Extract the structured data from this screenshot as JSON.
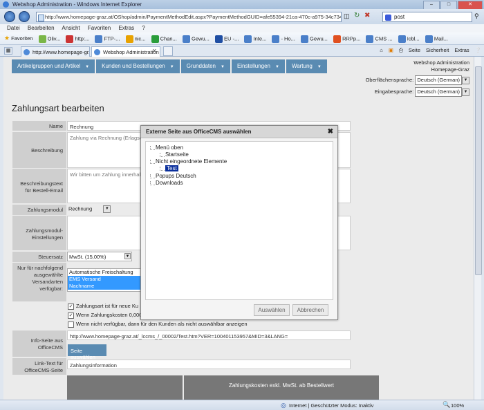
{
  "window": {
    "title": "Webshop Administration - Windows Internet Explorer"
  },
  "address": {
    "url": "http://www.homepage-graz.at/OShop/admin/PaymentMethodEdit.aspx?PaymentMethodGUID=afe55394-21ca-470c-a975-34c7348e6ed",
    "search": "post"
  },
  "menubar": [
    "Datei",
    "Bearbeiten",
    "Ansicht",
    "Favoriten",
    "Extras",
    "?"
  ],
  "favbar": {
    "label": "Favoriten",
    "items": [
      "Oliv...",
      "http:...",
      "FTP-...",
      "nic...",
      "Chan...",
      "Gewu...",
      "EU -...",
      "Inte...",
      "- Ho...",
      "Gewu...",
      "RRPp...",
      "CMS ...",
      "Icbl...",
      "Mail..."
    ]
  },
  "tabs": [
    {
      "label": "http://www.homepage-gr..."
    },
    {
      "label": "Webshop Administration"
    }
  ],
  "commandbar": [
    "Seite",
    "Sicherheit",
    "Extras"
  ],
  "nav": [
    {
      "label": "Artikelgruppen und Artikel"
    },
    {
      "label": "Kunden und Bestellungen"
    },
    {
      "label": "Grunddaten"
    },
    {
      "label": "Einstellungen"
    },
    {
      "label": "Wartung"
    }
  ],
  "header": {
    "line1": "Webshop Administration",
    "line2": "Homepage-Graz",
    "ui_lang_label": "Oberflächensprache:",
    "ui_lang_value": "Deutsch (German)",
    "input_lang_label": "Eingabesprache:",
    "input_lang_value": "Deutsch (German)"
  },
  "page_title": "Zahlungsart bearbeiten",
  "form": {
    "name_label": "Name",
    "name_value": "Rechnung",
    "desc_label": "Beschreibung",
    "desc_value": "Zahlung via Rechnung (Erlagsche",
    "email_desc_label": "Beschreibungstext für Bestell-Email",
    "email_desc_value": "Wir bitten um Zahlung innerhalb",
    "module_label": "Zahlungsmodul",
    "module_value": "Rechnung",
    "module_settings_label": "Zahlungsmodul-Einstellungen",
    "tax_label": "Steuersatz",
    "tax_value": "MwSt. (15,00%)",
    "shipping_label": "Nur für nachfolgend ausgewählte Versandarten verfügbar:",
    "shipping_options": [
      "Automatische Freischaltung",
      "EMS Versand",
      "Nachname"
    ],
    "check1": "Zahlungsart ist für neue Ku",
    "check2": "Wenn Zahlungskosten 0,000",
    "check3": "Wenn nicht verfügbar, dann für den Kunden als nicht auswählbar anzeigen",
    "info_page_label": "Info-Seite aus OfficeCMS",
    "info_page_value": "http://www.homepage-graz.at/_lccms_/_00002/Test.htm?VER=100401153957&MID=3&LANG=",
    "select_page_button": "Seite auswählen",
    "link_text_label": "Link-Text für OfficeCMS-Seite",
    "link_text_value": "Zahlungsinformation",
    "costs_header": "Zahlungskosten exkl. MwSt. ab Bestellwert"
  },
  "dialog": {
    "title": "Externe Seite aus OfficeCMS auswählen",
    "tree": [
      "Menü oben",
      "Startseite",
      "Nicht eingeordnete Elemente",
      "Test",
      "Popups Deutsch",
      "Downloads"
    ],
    "select_button": "Auswählen",
    "cancel_button": "Abbrechen"
  },
  "status": {
    "zone": "Internet | Geschützter Modus: Inaktiv",
    "zoom": "100%"
  },
  "colors": {
    "nav_blue": "#5a8bb2",
    "label_gray": "#cfcfcf",
    "highlight": "#0a2f9c"
  }
}
